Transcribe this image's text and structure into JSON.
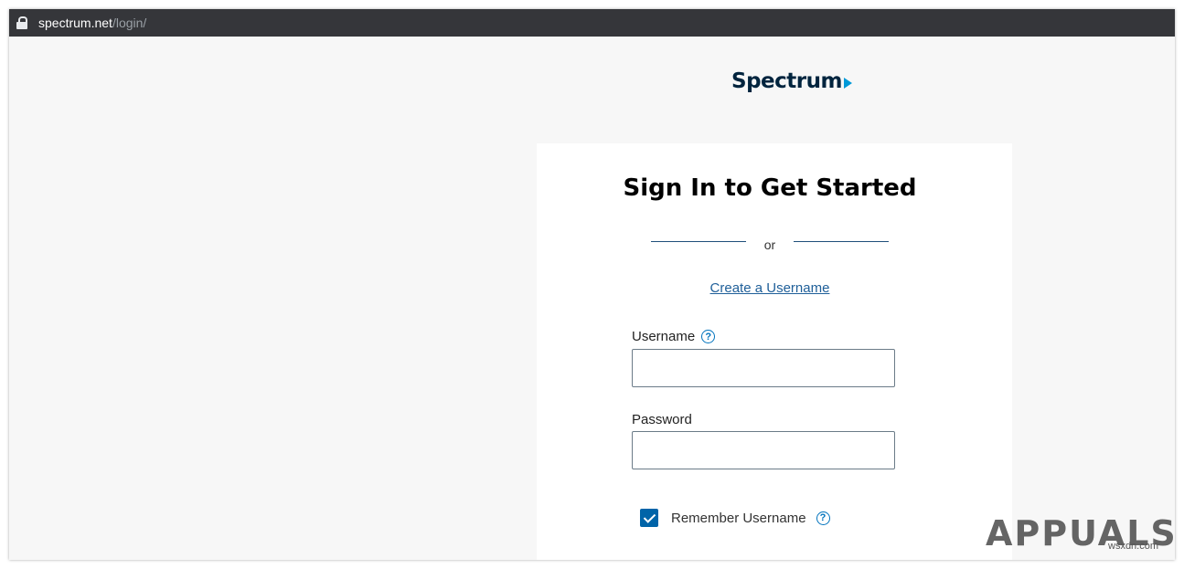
{
  "browser": {
    "url_host": "spectrum.net",
    "url_path": "/login/"
  },
  "brand": {
    "logo_text": "Spectrum",
    "logo_color": "#00243e",
    "accent_color": "#0099d8"
  },
  "login": {
    "title": "Sign In to Get Started",
    "divider_text": "or",
    "create_username_link": "Create a Username",
    "username_label": "Username",
    "username_value": "",
    "password_label": "Password",
    "password_value": "",
    "remember_label": "Remember Username",
    "remember_checked": true,
    "help_icon_glyph": "?"
  },
  "watermark": {
    "brand": "APPUALS",
    "site": "wsxdn.com"
  }
}
